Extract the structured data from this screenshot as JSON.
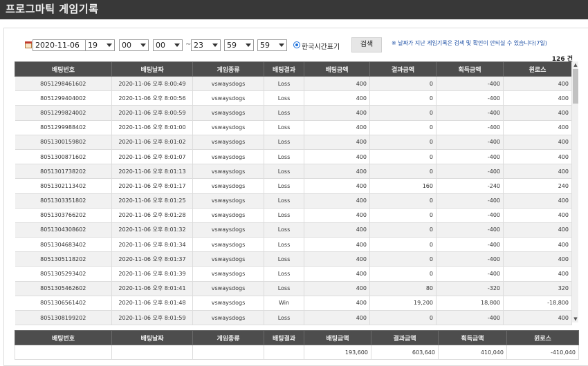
{
  "header": {
    "title": "프로그마틱 게임기록"
  },
  "controls": {
    "date": "2020-11-06",
    "start_hour": "19",
    "start_min": "00",
    "start_sec": "00",
    "separator": "~",
    "end_hour": "23",
    "end_min": "59",
    "end_sec": "59",
    "timezone_label": "한국시간표기",
    "search_label": "검색",
    "notice": "※ 날짜가 지난 게임기록은 검색 및 확인이 안되실 수 있습니다(7일)"
  },
  "count_text": "126 건",
  "columns": [
    "배팅번호",
    "배팅날짜",
    "게임종류",
    "배팅결과",
    "배팅금액",
    "결과금액",
    "획득금액",
    "윈로스"
  ],
  "rows": [
    [
      "8051298461602",
      "2020-11-06 오후 8:00:49",
      "vswaysdogs",
      "Loss",
      "400",
      "0",
      "-400",
      "400"
    ],
    [
      "8051299404002",
      "2020-11-06 오후 8:00:56",
      "vswaysdogs",
      "Loss",
      "400",
      "0",
      "-400",
      "400"
    ],
    [
      "8051299824002",
      "2020-11-06 오후 8:00:59",
      "vswaysdogs",
      "Loss",
      "400",
      "0",
      "-400",
      "400"
    ],
    [
      "8051299988402",
      "2020-11-06 오후 8:01:00",
      "vswaysdogs",
      "Loss",
      "400",
      "0",
      "-400",
      "400"
    ],
    [
      "8051300159802",
      "2020-11-06 오후 8:01:02",
      "vswaysdogs",
      "Loss",
      "400",
      "0",
      "-400",
      "400"
    ],
    [
      "8051300871602",
      "2020-11-06 오후 8:01:07",
      "vswaysdogs",
      "Loss",
      "400",
      "0",
      "-400",
      "400"
    ],
    [
      "8051301738202",
      "2020-11-06 오후 8:01:13",
      "vswaysdogs",
      "Loss",
      "400",
      "0",
      "-400",
      "400"
    ],
    [
      "8051302113402",
      "2020-11-06 오후 8:01:17",
      "vswaysdogs",
      "Loss",
      "400",
      "160",
      "-240",
      "240"
    ],
    [
      "8051303351802",
      "2020-11-06 오후 8:01:25",
      "vswaysdogs",
      "Loss",
      "400",
      "0",
      "-400",
      "400"
    ],
    [
      "8051303766202",
      "2020-11-06 오후 8:01:28",
      "vswaysdogs",
      "Loss",
      "400",
      "0",
      "-400",
      "400"
    ],
    [
      "8051304308602",
      "2020-11-06 오후 8:01:32",
      "vswaysdogs",
      "Loss",
      "400",
      "0",
      "-400",
      "400"
    ],
    [
      "8051304683402",
      "2020-11-06 오후 8:01:34",
      "vswaysdogs",
      "Loss",
      "400",
      "0",
      "-400",
      "400"
    ],
    [
      "8051305118202",
      "2020-11-06 오후 8:01:37",
      "vswaysdogs",
      "Loss",
      "400",
      "0",
      "-400",
      "400"
    ],
    [
      "8051305293402",
      "2020-11-06 오후 8:01:39",
      "vswaysdogs",
      "Loss",
      "400",
      "0",
      "-400",
      "400"
    ],
    [
      "8051305462602",
      "2020-11-06 오후 8:01:41",
      "vswaysdogs",
      "Loss",
      "400",
      "80",
      "-320",
      "320"
    ],
    [
      "8051306561402",
      "2020-11-06 오후 8:01:48",
      "vswaysdogs",
      "Win",
      "400",
      "19,200",
      "18,800",
      "-18,800"
    ],
    [
      "8051308199202",
      "2020-11-06 오후 8:01:59",
      "vswaysdogs",
      "Loss",
      "400",
      "0",
      "-400",
      "400"
    ]
  ],
  "totals": [
    "",
    "",
    "",
    "",
    "193,600",
    "603,640",
    "410,040",
    "-410,040"
  ]
}
